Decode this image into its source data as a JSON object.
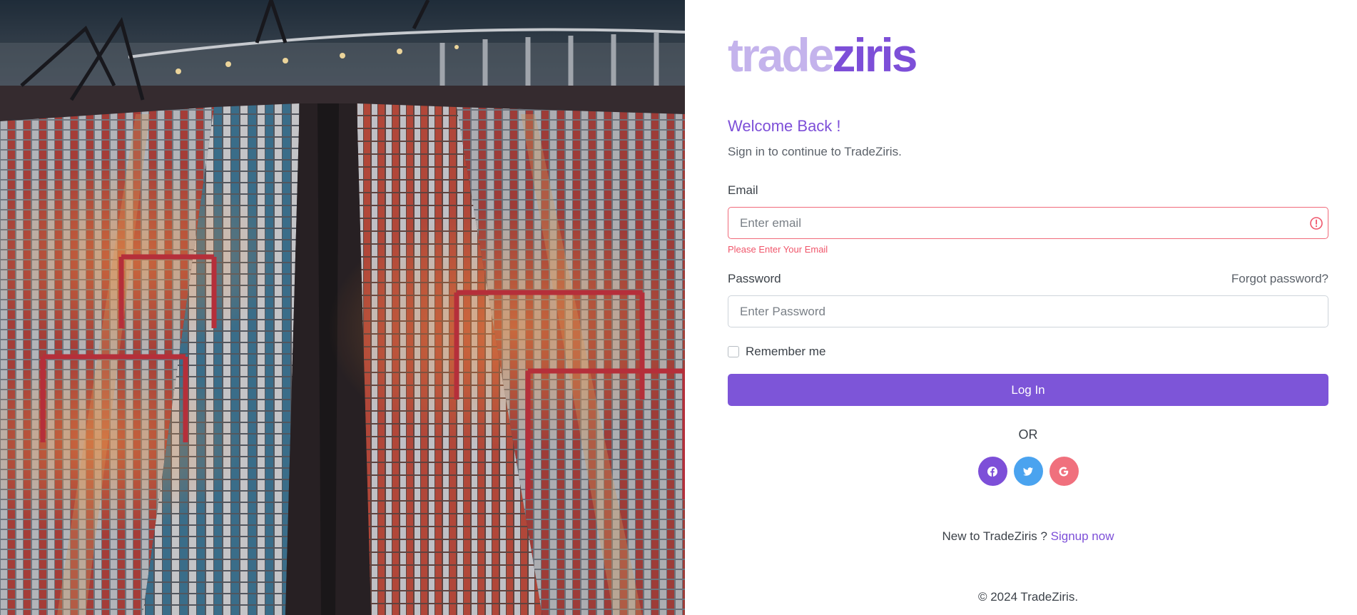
{
  "brand": {
    "logo_light": "trade",
    "logo_dark": "ziris",
    "colors": {
      "primary": "#7d4fd8",
      "primary_light": "#c4b3ec",
      "error": "#f0566b",
      "twitter": "#4aa3ef",
      "google": "#f0707d"
    }
  },
  "hero": {
    "image": "aerial-container-port-night"
  },
  "auth": {
    "welcome": "Welcome Back !",
    "subtitle": "Sign in to continue to TradeZiris.",
    "email": {
      "label": "Email",
      "placeholder": "Enter email",
      "value": "",
      "error": "Please Enter Your Email",
      "state_icon": "alert-circle-icon"
    },
    "password": {
      "label": "Password",
      "placeholder": "Enter Password",
      "value": "",
      "forgot_label": "Forgot password?"
    },
    "remember": {
      "label": "Remember me",
      "checked": false
    },
    "login_label": "Log In",
    "or_label": "OR",
    "social": [
      {
        "name": "facebook",
        "icon": "facebook-icon"
      },
      {
        "name": "twitter",
        "icon": "twitter-icon"
      },
      {
        "name": "google",
        "icon": "google-icon"
      }
    ],
    "signup_prompt": "New to TradeZiris ?",
    "signup_link": "Signup now",
    "copyright": "© 2024 TradeZiris."
  }
}
